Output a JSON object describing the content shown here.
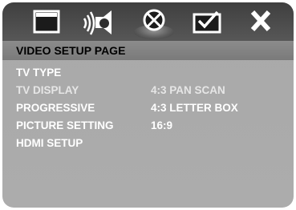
{
  "header": {
    "tabs": [
      {
        "icon": "general-setup-icon"
      },
      {
        "icon": "audio-setup-icon"
      },
      {
        "icon": "video-setup-icon",
        "selected": true
      },
      {
        "icon": "preference-setup-icon"
      },
      {
        "icon": "exit-icon"
      }
    ]
  },
  "page_title": "VIDEO SETUP PAGE",
  "menu": {
    "items": [
      {
        "label": "TV TYPE"
      },
      {
        "label": "TV DISPLAY",
        "selected": true
      },
      {
        "label": "PROGRESSIVE"
      },
      {
        "label": "PICTURE SETTING"
      },
      {
        "label": "HDMI SETUP"
      }
    ]
  },
  "options": [
    {
      "label": "4:3 PAN SCAN"
    },
    {
      "label": "4:3 LETTER BOX"
    },
    {
      "label": "16:9"
    }
  ],
  "colors": {
    "header_bg": "#3f3f3f",
    "title_bar_bg": "#8c8c8c",
    "body_bg": "#a9a9a9",
    "text": "#ffffff"
  }
}
